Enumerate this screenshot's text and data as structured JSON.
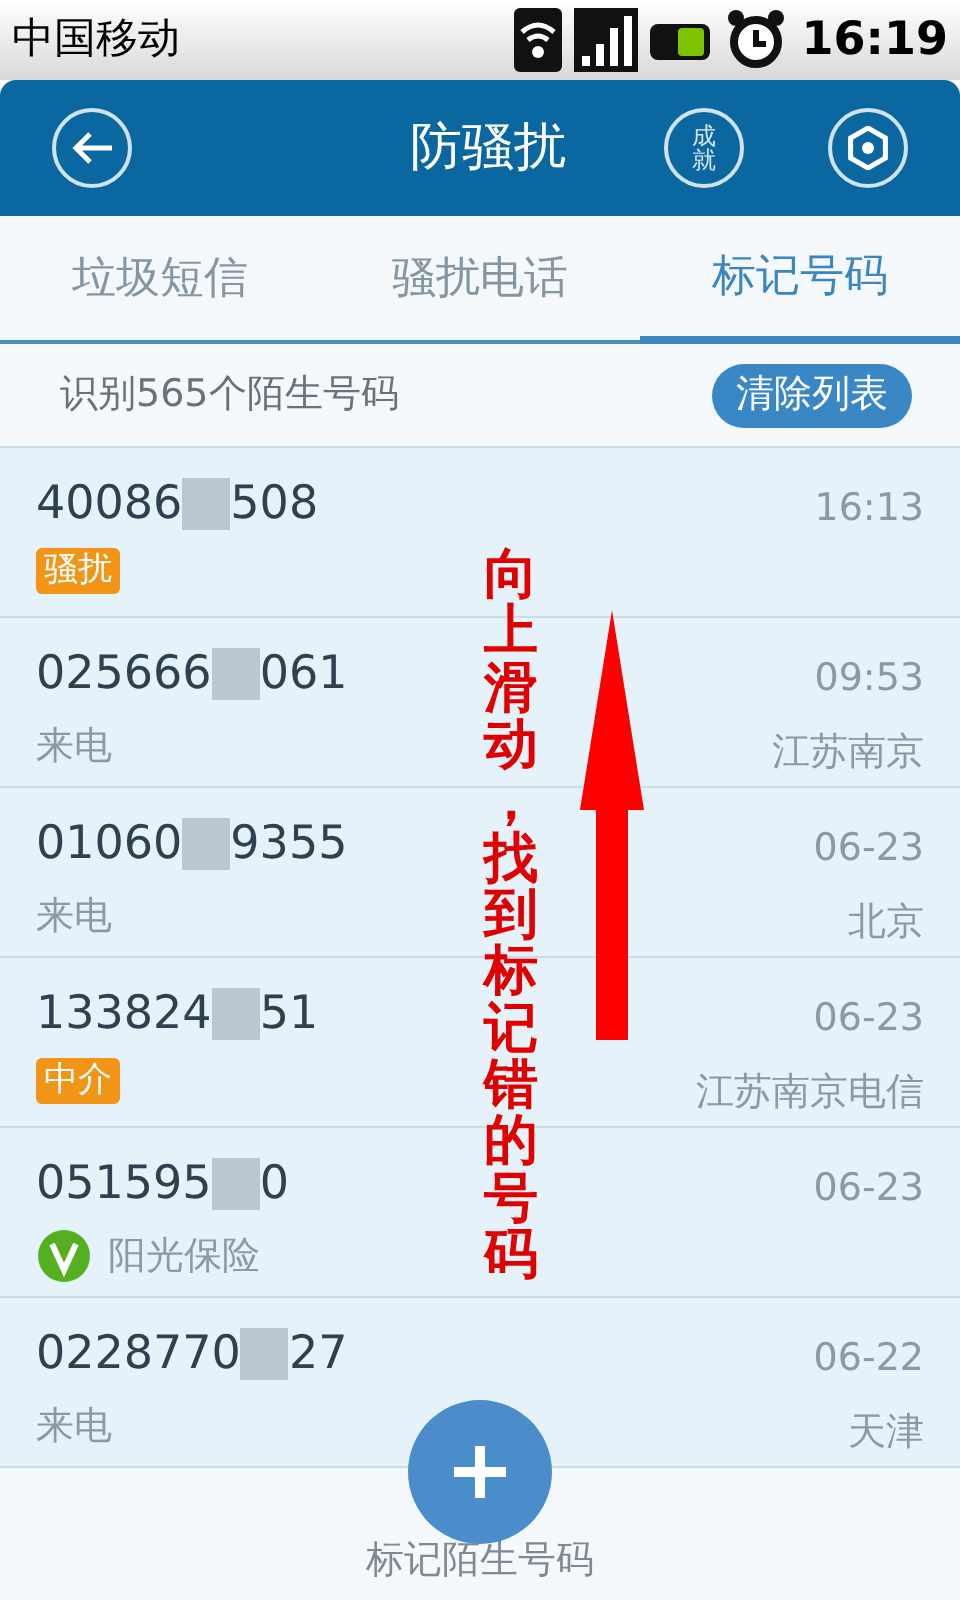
{
  "status_bar": {
    "carrier": "中国移动",
    "time": "16:19"
  },
  "header": {
    "title": "防骚扰",
    "achievement_label": "成就"
  },
  "tabs": [
    {
      "label": "垃圾短信",
      "selected": false
    },
    {
      "label": "骚扰电话",
      "selected": false
    },
    {
      "label": "标记号码",
      "selected": true
    }
  ],
  "summary": {
    "text": "识别565个陌生号码",
    "clear_button": "清除列表"
  },
  "rows": [
    {
      "number_start": "40086",
      "number_end": "508",
      "time": "16:13",
      "kind": "tag",
      "label": "骚扰"
    },
    {
      "number_start": "025666",
      "number_end": "061",
      "time": "09:53",
      "kind": "plain",
      "label": "来电",
      "location": "江苏南京"
    },
    {
      "number_start": "01060",
      "number_end": "9355",
      "time": "06-23",
      "kind": "plain",
      "label": "来电",
      "location": "北京"
    },
    {
      "number_start": "133824",
      "number_end": "51",
      "time": "06-23",
      "kind": "tag",
      "label": "中介",
      "location": "江苏南京电信"
    },
    {
      "number_start": "051595",
      "number_end": "0",
      "time": "06-23",
      "kind": "verified",
      "label": "阳光保险"
    },
    {
      "number_start": "0228770",
      "number_end": "27",
      "time": "06-22",
      "kind": "plain",
      "label": "来电",
      "location": "天津"
    }
  ],
  "annotation": {
    "text": "向上滑动，找到标记错的号码"
  },
  "bottom": {
    "add_label": "标记陌生号码"
  }
}
